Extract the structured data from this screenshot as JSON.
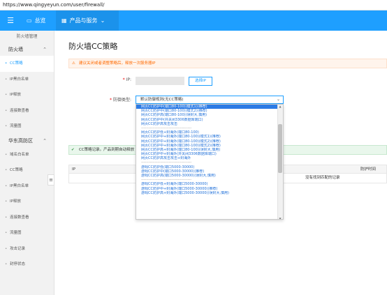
{
  "address_bar": {
    "url": "https://www.qingyeyun.com/user/firewall/"
  },
  "topnav": {
    "menu_icon": "menu-icon",
    "home_label": "总览",
    "products_label": "产品与服务"
  },
  "sidebar": {
    "title": "防火墙管理",
    "groups": [
      {
        "label": "防火墙",
        "items": [
          "CC策略",
          "IP黑白名单",
          "IP释放",
          "连接数查看",
          "流量图"
        ]
      },
      {
        "label": "华东高防区",
        "items": [
          "域名白名单",
          "CC策略",
          "IP黑白名单",
          "IP释放",
          "连接数查看",
          "流量图",
          "攻击记录",
          "封停状态"
        ]
      }
    ]
  },
  "main": {
    "title": "防火墙CC策略",
    "warning": "建议关闭或者调整策略后，释放一次服务器IP",
    "ip_label": "IP:",
    "select_ip_button": "选择IP",
    "defense_label": "防御类型:",
    "defense_selected": "默认防御规则(无CC策略)",
    "success_msg": "CC策略记录。产品到期自动释放",
    "table": {
      "col_ip": "IP",
      "col_time": "防护时间",
      "empty": "没有找到匹配的记录"
    }
  },
  "dropdown": {
    "options": [
      {
        "text": "网页CC防护中(端口80-100)(模式1)(推荐)",
        "sep": false,
        "highlight": true
      },
      {
        "text": "网页CC防护中(端口80-100)(模式2)(推荐)",
        "sep": false
      },
      {
        "text": "网页CC防护高(端口80-100)(误封大,慎用)",
        "sep": false
      },
      {
        "text": "网页CC防护中(共关闭3306数据库端口)",
        "sep": false
      },
      {
        "text": "网页CC防护高攻击攻击",
        "sep": false
      },
      {
        "text": "----------------------------------------",
        "sep": true
      },
      {
        "text": "网页CC防护低+封海外(端口80-100)",
        "sep": false
      },
      {
        "text": "网页CC防护中+封海外(端口80-100)(模式1)(推荐)",
        "sep": false
      },
      {
        "text": "网页CC防护中+封海外(端口80-100)(模式2)(推荐)",
        "sep": false
      },
      {
        "text": "网页CC防护中+封海外(端口80-100)(模式2)(推荐)",
        "sep": false
      },
      {
        "text": "网页CC防护高+封海外(端口80-100)(误封大,慎用)",
        "sep": false
      },
      {
        "text": "网页CC防护中+封海外(并关闭3306数据库端口)",
        "sep": false
      },
      {
        "text": "网页CC防护高攻击攻击+封海外",
        "sep": false
      },
      {
        "text": "----------------------------------------",
        "sep": true
      },
      {
        "text": "游戏CC防护低(端口5000-30000)",
        "sep": false
      },
      {
        "text": "游戏CC防护中(端口5000-30000)(推荐)",
        "sep": false
      },
      {
        "text": "游戏CC防护高(端口5000-30000)(误封大,慎用)",
        "sep": false
      },
      {
        "text": "----------------------------------------",
        "sep": true
      },
      {
        "text": "游戏CC防护低+封海外(端口5000-30000)",
        "sep": false
      },
      {
        "text": "游戏CC防护中+封海外(端口5000-30000)(推荐)",
        "sep": false
      },
      {
        "text": "游戏CC防护高+封海外(端口5000-30000)(误封大,慎用)",
        "sep": false
      }
    ]
  }
}
